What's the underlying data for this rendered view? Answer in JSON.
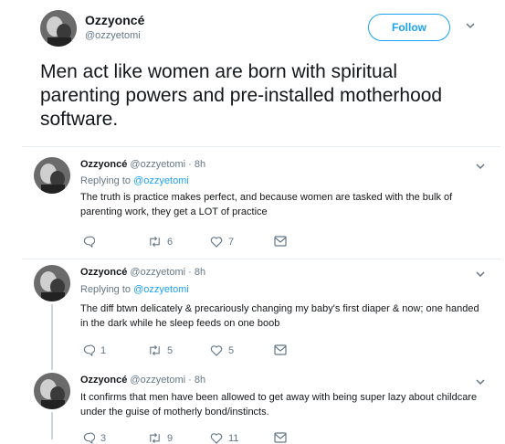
{
  "main_tweet": {
    "name": "Ozzyoncé",
    "handle": "@ozzyetomi",
    "follow_label": "Follow",
    "text": "Men act like women are born with spiritual parenting powers and pre-installed motherhood software."
  },
  "replies": [
    {
      "name": "Ozzyoncé",
      "handle_time": "@ozzyetomi · 8h",
      "replying_prefix": "Replying to",
      "replying_handle": "@ozzyetomi",
      "text": "The truth is practice makes perfect, and because women are tasked with the bulk of parenting work, they get a LOT of practice",
      "reply_count": "",
      "retweet_count": "6",
      "like_count": "7"
    },
    {
      "name": "Ozzyoncé",
      "handle_time": "@ozzyetomi · 8h",
      "replying_prefix": "Replying to",
      "replying_handle": "@ozzyetomi",
      "text": "The diff btwn delicately & precariously changing my baby's first diaper & now; one handed in the dark while he sleep feeds on one boob",
      "reply_count": "1",
      "retweet_count": "5",
      "like_count": "5"
    },
    {
      "name": "Ozzyoncé",
      "handle_time": "@ozzyetomi · 8h",
      "text": "It confirms that men have been allowed to get away with being super lazy about childcare under the guise of motherly bond/instincts.",
      "reply_count": "3",
      "retweet_count": "9",
      "like_count": "11"
    }
  ],
  "icons": {
    "chevron": "chevron-down-icon",
    "reply": "reply-icon",
    "retweet": "retweet-icon",
    "like": "heart-icon",
    "message": "envelope-icon"
  },
  "colors": {
    "accent": "#1da1f2",
    "muted": "#657786",
    "text": "#14171a"
  }
}
